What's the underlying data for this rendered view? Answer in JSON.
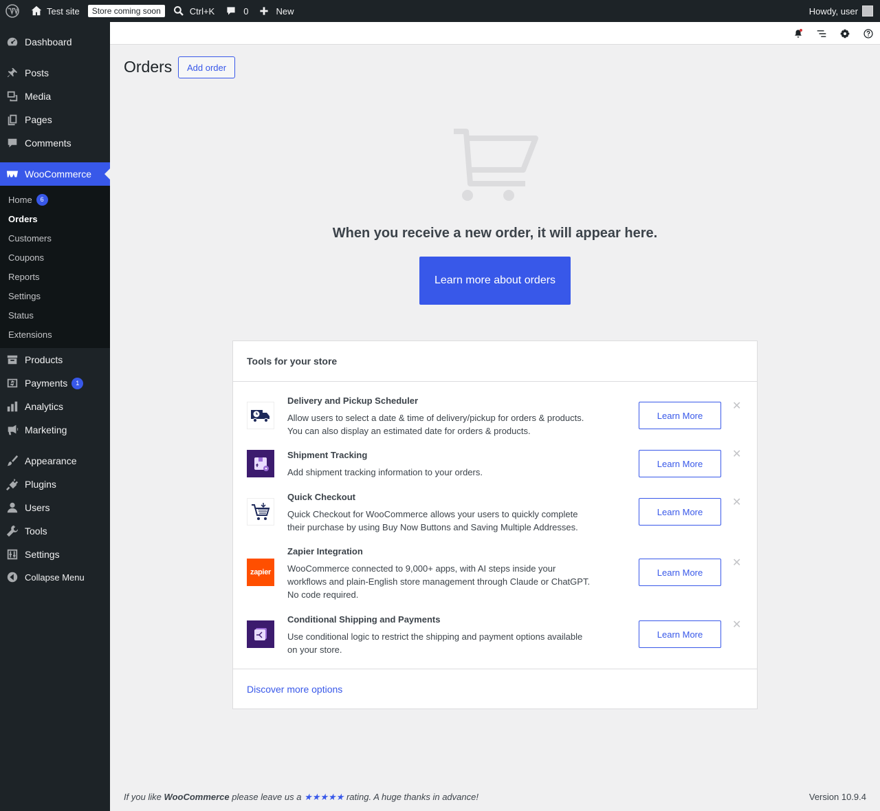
{
  "adminbar": {
    "site_name": "Test site",
    "store_badge": "Store coming soon",
    "search_shortcut": "Ctrl+K",
    "comments_count": "0",
    "new_label": "New",
    "howdy": "Howdy, user"
  },
  "sidebar": {
    "items": [
      {
        "label": "Dashboard",
        "icon": "dashboard-icon"
      },
      {
        "label": "Posts",
        "icon": "pin-icon"
      },
      {
        "label": "Media",
        "icon": "media-icon"
      },
      {
        "label": "Pages",
        "icon": "pages-icon"
      },
      {
        "label": "Comments",
        "icon": "comment-icon"
      },
      {
        "label": "WooCommerce",
        "icon": "woocommerce-icon"
      },
      {
        "label": "Products",
        "icon": "archive-icon"
      },
      {
        "label": "Payments",
        "icon": "money-icon",
        "badge": "1"
      },
      {
        "label": "Analytics",
        "icon": "chart-icon"
      },
      {
        "label": "Marketing",
        "icon": "megaphone-icon"
      },
      {
        "label": "Appearance",
        "icon": "brush-icon"
      },
      {
        "label": "Plugins",
        "icon": "plug-icon"
      },
      {
        "label": "Users",
        "icon": "user-icon"
      },
      {
        "label": "Tools",
        "icon": "wrench-icon"
      },
      {
        "label": "Settings",
        "icon": "sliders-icon"
      },
      {
        "label": "Collapse Menu",
        "icon": "collapse-icon"
      }
    ],
    "submenu": [
      {
        "label": "Home",
        "badge": "6"
      },
      {
        "label": "Orders"
      },
      {
        "label": "Customers"
      },
      {
        "label": "Coupons"
      },
      {
        "label": "Reports"
      },
      {
        "label": "Settings"
      },
      {
        "label": "Status"
      },
      {
        "label": "Extensions"
      }
    ]
  },
  "main": {
    "title": "Orders",
    "add_order": "Add order",
    "empty_message": "When you receive a new order, it will appear here.",
    "learn_orders": "Learn more about orders"
  },
  "tools": {
    "heading": "Tools for your store",
    "items": [
      {
        "title": "Delivery and Pickup Scheduler",
        "desc": "Allow users to select a date & time of delivery/pickup for orders & products. You can also display an estimated date for orders & products.",
        "button": "Learn More",
        "icon": "delivery-truck-icon"
      },
      {
        "title": "Shipment Tracking",
        "desc": "Add shipment tracking information to your orders.",
        "button": "Learn More",
        "icon": "shipment-box-icon"
      },
      {
        "title": "Quick Checkout",
        "desc": "Quick Checkout for WooCommerce allows your users to quickly complete their purchase by using Buy Now Buttons and Saving Multiple Addresses.",
        "button": "Learn More",
        "icon": "cart-icon"
      },
      {
        "title": "Zapier Integration",
        "desc": "WooCommerce connected to 9,000+ apps, with AI steps inside your workflows and plain-English store management through Claude or ChatGPT. No code required.",
        "button": "Learn More",
        "icon": "zapier-logo",
        "logo_text": "zapier"
      },
      {
        "title": "Conditional Shipping and Payments",
        "desc": "Use conditional logic to restrict the shipping and payment options available on your store.",
        "button": "Learn More",
        "icon": "conditional-icon"
      }
    ],
    "discover": "Discover more options"
  },
  "footer": {
    "prefix": "If you like ",
    "brand": "WooCommerce",
    "middle": " please leave us a ",
    "stars": "★★★★★",
    "suffix": " rating. A huge thanks in advance!",
    "version": "Version 10.9.4"
  },
  "colors": {
    "accent": "#3858e9",
    "sidebar": "#1d2327",
    "submenu": "#101517"
  }
}
